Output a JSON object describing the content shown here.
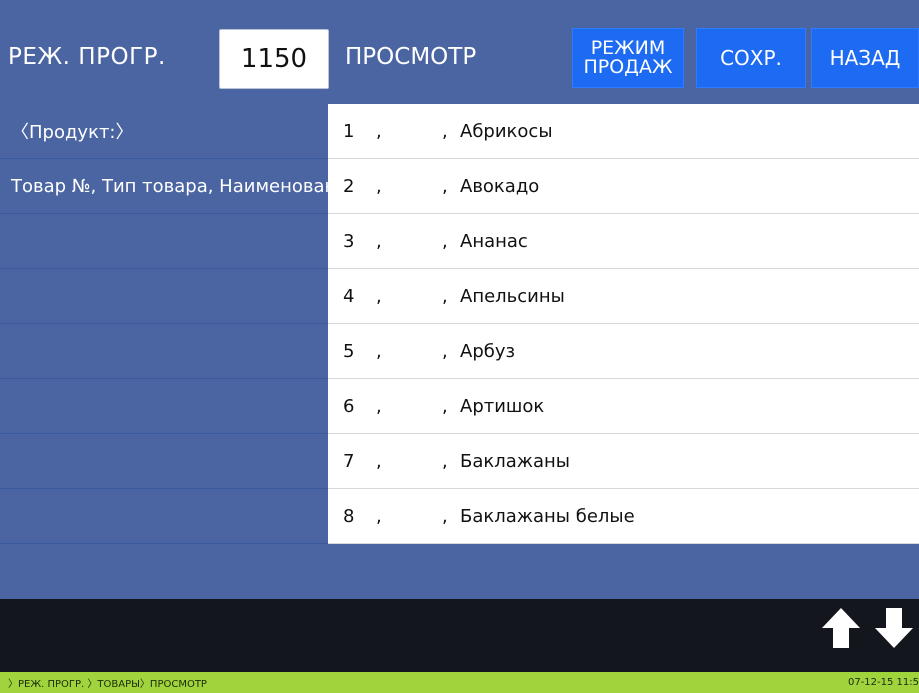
{
  "header": {
    "mode_title": "РЕЖ. ПРОГР.",
    "code": "1150",
    "view_title": "ПРОСМОТР",
    "sales_mode_line1": "РЕЖИМ",
    "sales_mode_line2": "ПРОДАЖ",
    "save_label": "СОХР.",
    "back_label": "НАЗАД"
  },
  "left_panel": {
    "product_label": "〈Продукт:〉",
    "fields_label": "Товар №, Тип товара, Наименование"
  },
  "list": {
    "items": [
      {
        "num": "1",
        "sep1": ",",
        "sep2": ",",
        "name": "Абрикосы"
      },
      {
        "num": "2",
        "sep1": ",",
        "sep2": ",",
        "name": "Авокадо"
      },
      {
        "num": "3",
        "sep1": ",",
        "sep2": ",",
        "name": "Ананас"
      },
      {
        "num": "4",
        "sep1": ",",
        "sep2": ",",
        "name": "Апельсины"
      },
      {
        "num": "5",
        "sep1": ",",
        "sep2": ",",
        "name": "Арбуз"
      },
      {
        "num": "6",
        "sep1": ",",
        "sep2": ",",
        "name": "Артишок"
      },
      {
        "num": "7",
        "sep1": ",",
        "sep2": ",",
        "name": "Баклажаны"
      },
      {
        "num": "8",
        "sep1": ",",
        "sep2": ",",
        "name": "Баклажаны белые"
      }
    ]
  },
  "navigation": {
    "up_icon": "arrow-up-icon",
    "down_icon": "arrow-down-icon"
  },
  "status": {
    "breadcrumb": "〉РЕЖ. ПРОГР. 〉ТОВАРЫ〉ПРОСМОТР",
    "datetime": "07-12-15 11:5"
  },
  "colors": {
    "background": "#4b65a2",
    "button": "#1d6bf2",
    "status_bar": "#9fd43d",
    "dark_bar": "#13161c"
  }
}
